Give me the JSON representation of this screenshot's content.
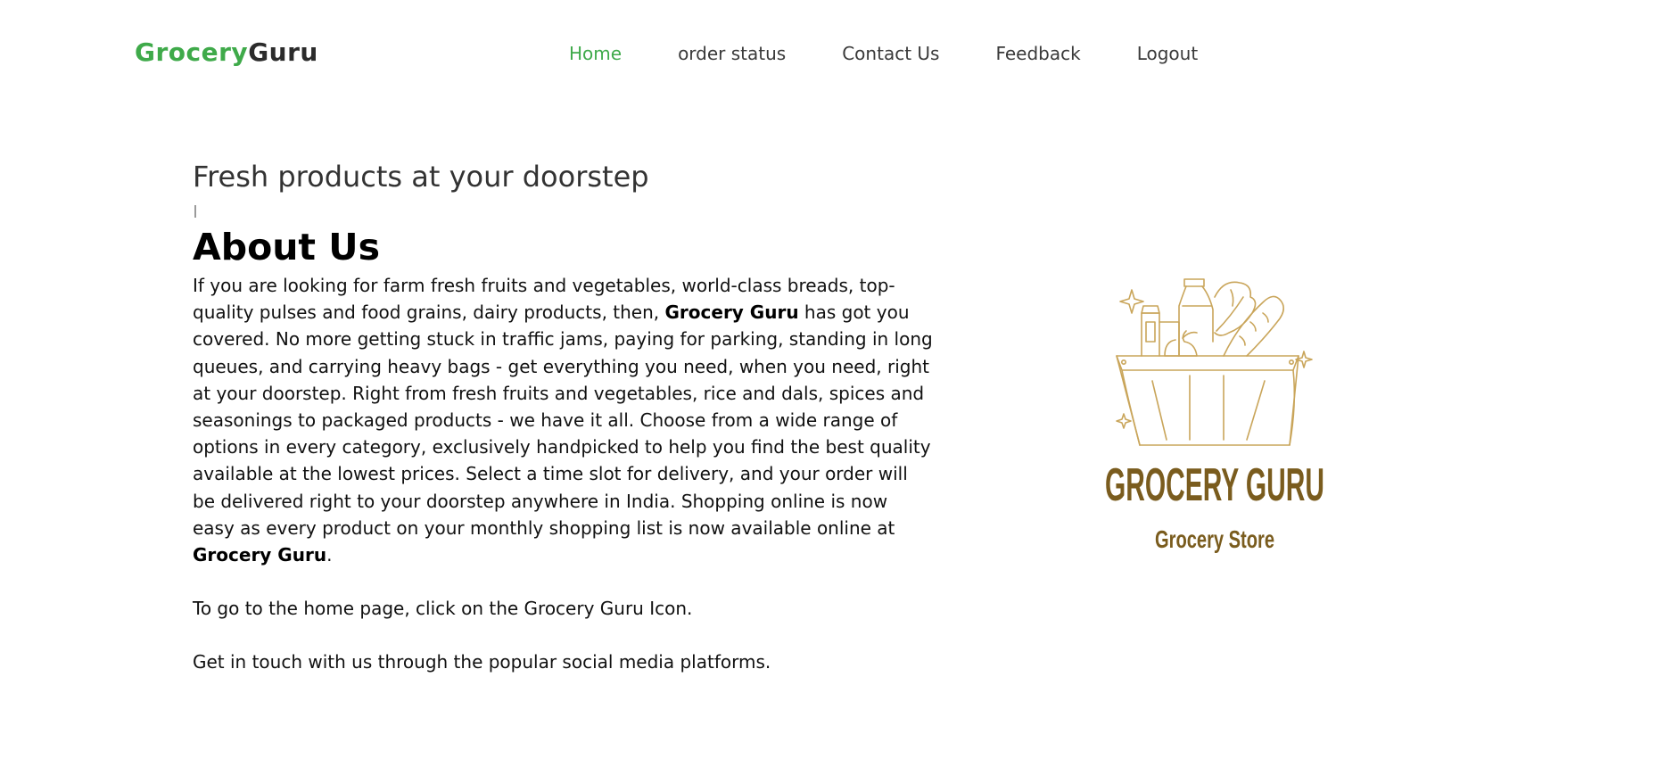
{
  "navbar": {
    "logo_part1": "Grocery",
    "logo_part2": "Guru",
    "links": [
      {
        "label": "Home",
        "active": true
      },
      {
        "label": "order status",
        "active": false
      },
      {
        "label": "Contact Us",
        "active": false
      },
      {
        "label": "Feedback",
        "active": false
      },
      {
        "label": "Logout",
        "active": false
      }
    ]
  },
  "hero": {
    "tagline": "Fresh products at your doorstep"
  },
  "about": {
    "title": "About Us",
    "paragraph_part1": "If you are looking for farm fresh fruits and vegetables, world-class breads, top-quality pulses and food grains, dairy products, then, ",
    "brand_bold_1": "Grocery Guru",
    "paragraph_part2": " has got you covered. No more getting stuck in traffic jams, paying for parking, standing in long queues, and carrying heavy bags - get everything you need, when you need, right at your doorstep. Right from fresh fruits and vegetables, rice and dals, spices and seasonings to packaged products - we have it all. Choose from a wide range of options in every category, exclusively handpicked to help you find the best quality available at the lowest prices. Select a time slot for delivery, and your order will be delivered right to your doorstep anywhere in India. Shopping online is now easy as every product on your monthly shopping list is now available online at ",
    "brand_bold_2": "Grocery Guru",
    "paragraph_part3": ".",
    "home_note": "To go to the home page, click on the Grocery Guru Icon.",
    "social_note": "Get in touch with us through the popular social media platforms."
  },
  "brand_logo": {
    "title": "GROCERY GURU",
    "subtitle": "Grocery Store",
    "icon": "grocery-basket-icon",
    "color": "#7a5c1e",
    "line_color": "#c9a55a"
  },
  "colors": {
    "accent": "#3faa4a",
    "text": "#111111"
  }
}
